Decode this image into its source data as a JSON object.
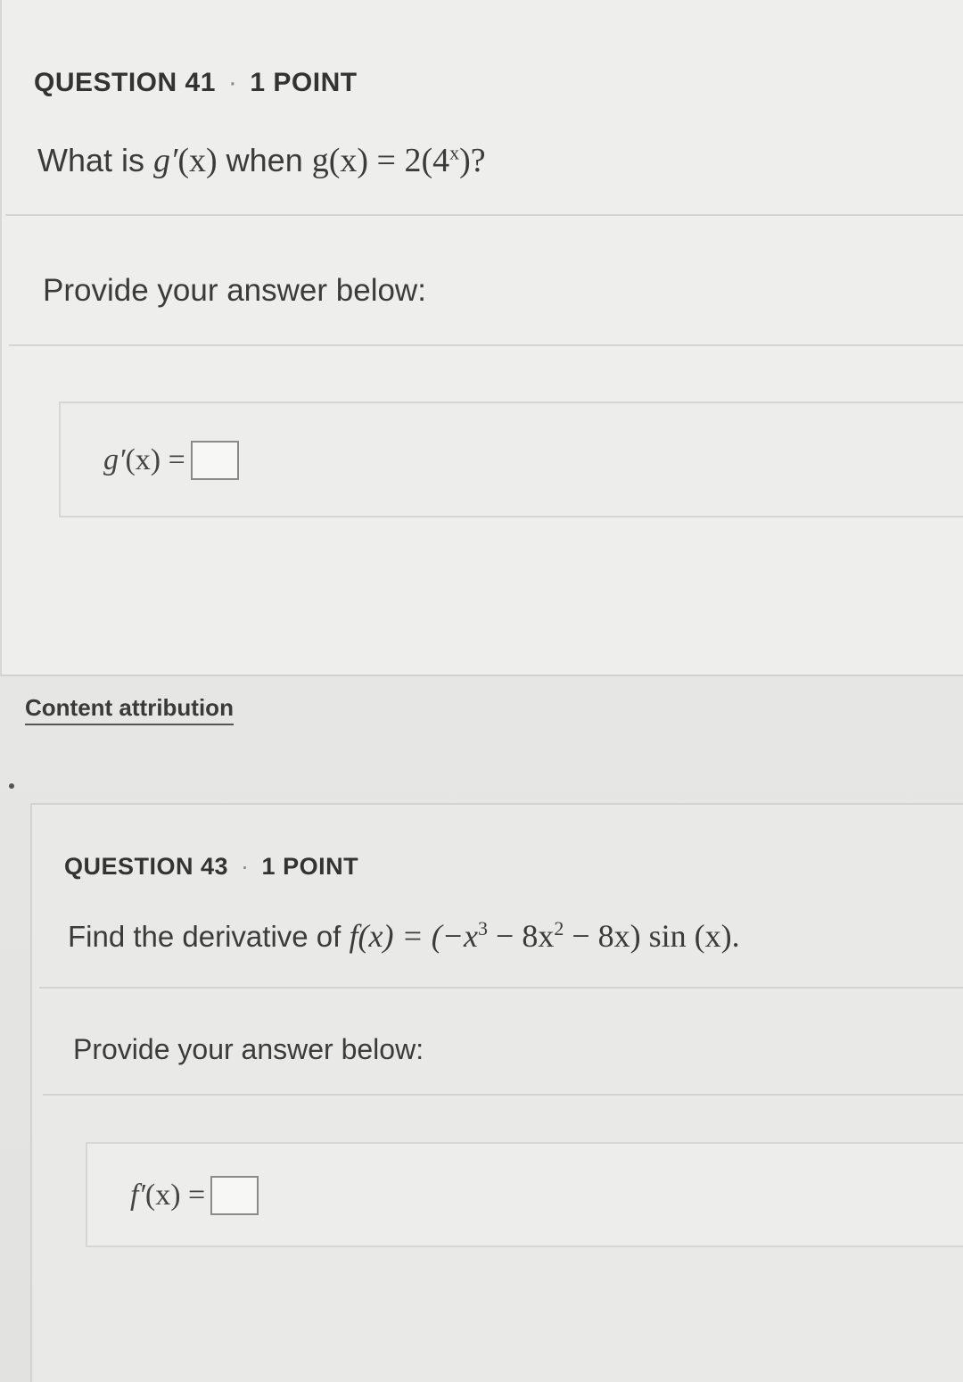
{
  "q41": {
    "header_number": "QUESTION 41",
    "header_separator": "·",
    "header_points": "1 POINT",
    "question_prefix": "What is ",
    "question_func": "g′",
    "question_arg": "(x)",
    "question_mid": " when ",
    "question_g": "g(x) = 2(4",
    "question_exp": "x",
    "question_end": ")?",
    "prompt": "Provide your answer below:",
    "answer_label_func": "g′",
    "answer_label_rest": "(x) ="
  },
  "attribution": {
    "label": "Content attribution"
  },
  "q43": {
    "header_number": "QUESTION 43",
    "header_separator": "·",
    "header_points": "1 POINT",
    "question_prefix": "Find the derivative of ",
    "question_math_a": "f(x) = (−x",
    "question_sup1": "3",
    "question_math_b": " − 8x",
    "question_sup2": "2",
    "question_math_c": " − 8x) sin (x).",
    "prompt": "Provide your answer below:",
    "answer_label_func": "f′",
    "answer_label_rest": "(x) ="
  },
  "colors": {
    "background": "#ececea",
    "text": "#3a3a3a",
    "border": "#d4d4d2"
  }
}
